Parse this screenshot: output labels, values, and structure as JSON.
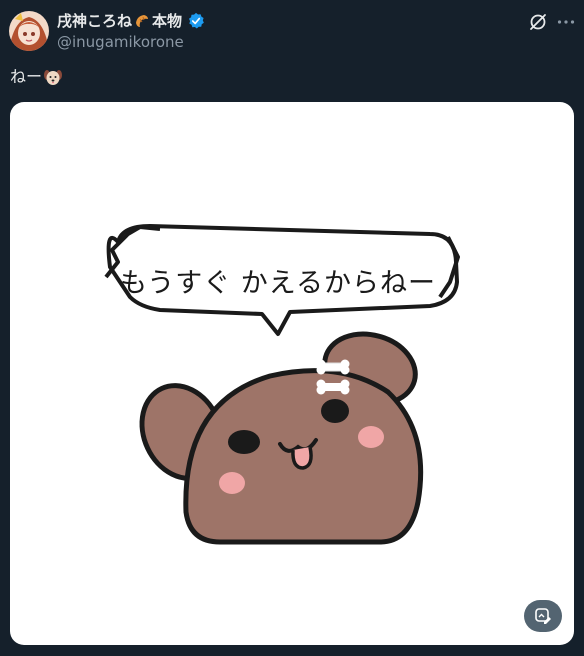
{
  "author": {
    "display_name": "戌神ころね",
    "suffix": "本物",
    "handle": "@inugamikorone",
    "verified": true,
    "avatar_icon": "avatar-image"
  },
  "tweet": {
    "text": "ねー",
    "emoji_icon": "dog-face-icon"
  },
  "media": {
    "speech_bubble_text": "もうすぐ かえるからねー",
    "edit_button_icon": "image-edit-icon"
  },
  "colors": {
    "background": "#15202b",
    "text_primary": "#e7e9ea",
    "text_secondary": "#8b98a5",
    "verified_blue": "#1d9bf0",
    "dog_brown": "#9e7468",
    "cheek_pink": "#f0a6a6"
  }
}
